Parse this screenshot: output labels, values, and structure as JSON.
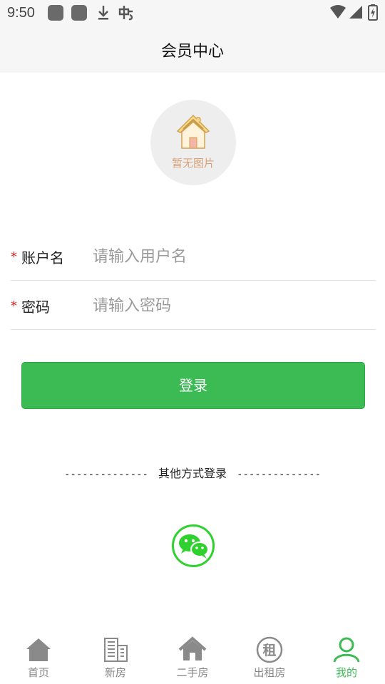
{
  "status_bar": {
    "time": "9:50"
  },
  "header": {
    "title": "会员中心"
  },
  "avatar": {
    "placeholder_text": "暂无图片"
  },
  "form": {
    "username": {
      "required_mark": "*",
      "label": "账户名",
      "placeholder": "请输入用户名",
      "value": ""
    },
    "password": {
      "required_mark": "*",
      "label": "密码",
      "placeholder": "请输入密码",
      "value": ""
    }
  },
  "login_button": {
    "label": "登录"
  },
  "other_login": {
    "left_dashes": "--------------",
    "text": "其他方式登录",
    "right_dashes": "--------------"
  },
  "tabs": [
    {
      "label": "首页",
      "icon": "home-icon",
      "active": false
    },
    {
      "label": "新房",
      "icon": "building-icon",
      "active": false
    },
    {
      "label": "二手房",
      "icon": "house-icon",
      "active": false
    },
    {
      "label": "出租房",
      "icon": "rent-icon",
      "active": false,
      "glyph": "租"
    },
    {
      "label": "我的",
      "icon": "user-icon",
      "active": true
    }
  ],
  "colors": {
    "accent": "#3cba54",
    "wechat_green": "#2ed12e",
    "required_red": "#e02020",
    "tab_inactive": "#888888"
  }
}
